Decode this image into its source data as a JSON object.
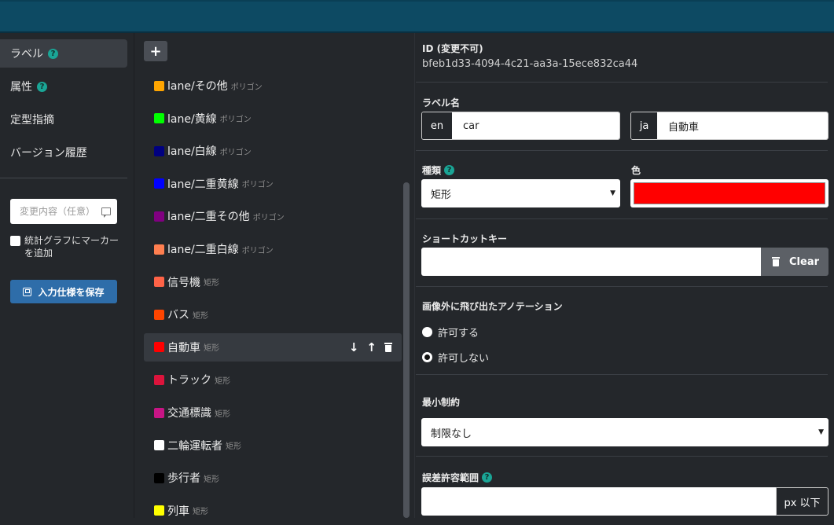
{
  "nav": {
    "items": [
      {
        "label": "ラベル",
        "help": true,
        "active": true
      },
      {
        "label": "属性",
        "help": true,
        "active": false
      },
      {
        "label": "定型指摘",
        "help": false,
        "active": false
      },
      {
        "label": "バージョン履歴",
        "help": false,
        "active": false
      }
    ],
    "help_glyph": "?",
    "comment_placeholder": "変更内容（任意）",
    "marker_checkbox_label": "統計グラフにマーカーを追加",
    "save_button_label": "入力仕様を保存"
  },
  "label_list": {
    "add_glyph": "+",
    "items": [
      {
        "name": "lane/その他",
        "kind": "ポリゴン",
        "color": "#ffa500"
      },
      {
        "name": "lane/黄線",
        "kind": "ポリゴン",
        "color": "#00ff00"
      },
      {
        "name": "lane/白線",
        "kind": "ポリゴン",
        "color": "#000080"
      },
      {
        "name": "lane/二重黄線",
        "kind": "ポリゴン",
        "color": "#0000ff"
      },
      {
        "name": "lane/二重その他",
        "kind": "ポリゴン",
        "color": "#800080"
      },
      {
        "name": "lane/二重白線",
        "kind": "ポリゴン",
        "color": "#ff7f50"
      },
      {
        "name": "信号機",
        "kind": "矩形",
        "color": "#ff6347"
      },
      {
        "name": "バス",
        "kind": "矩形",
        "color": "#ff4500"
      },
      {
        "name": "自動車",
        "kind": "矩形",
        "color": "#ff0000",
        "selected": true
      },
      {
        "name": "トラック",
        "kind": "矩形",
        "color": "#dc143c"
      },
      {
        "name": "交通標識",
        "kind": "矩形",
        "color": "#c71585"
      },
      {
        "name": "二輪運転者",
        "kind": "矩形",
        "color": "#ffffff"
      },
      {
        "name": "歩行者",
        "kind": "矩形",
        "color": "#000000"
      },
      {
        "name": "列車",
        "kind": "矩形",
        "color": "#ffff00"
      }
    ],
    "action_down": "↓",
    "action_up": "↑"
  },
  "detail": {
    "id_label": "ID (変更不可)",
    "id_value": "bfeb1d33-4094-4c21-aa3a-15ece832ca44",
    "name_label": "ラベル名",
    "name_en_tag": "en",
    "name_en_value": "car",
    "name_ja_tag": "ja",
    "name_ja_value": "自動車",
    "type_label": "種類",
    "type_value": "矩形",
    "color_label": "色",
    "color_value": "#ff0000",
    "shortcut_label": "ショートカットキー",
    "shortcut_value": "",
    "clear_label": "Clear",
    "outside_label": "画像外に飛び出たアノテーション",
    "outside_options": [
      "許可する",
      "許可しない"
    ],
    "outside_selected": 1,
    "min_label": "最小制約",
    "min_value": "制限なし",
    "tolerance_label": "誤差許容範囲",
    "tolerance_value": "",
    "tolerance_unit": "px 以下",
    "caret": "▼"
  }
}
